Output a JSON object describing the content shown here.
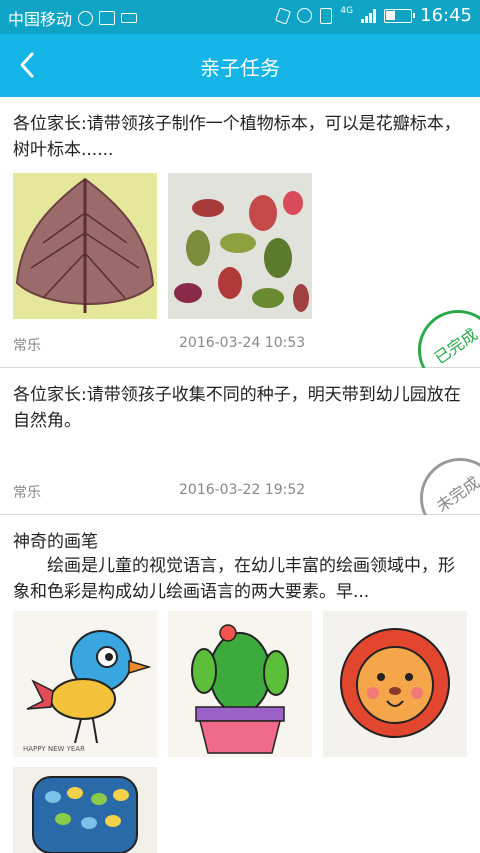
{
  "status_bar": {
    "carrier": "中国移动",
    "network": "4G",
    "time": "16:45",
    "icons": [
      "wechat-icon",
      "image-icon",
      "keyboard-icon",
      "vibrate-icon",
      "alarm-icon",
      "sim-icon",
      "signal-icon",
      "battery-icon"
    ]
  },
  "header": {
    "title": "亲子任务",
    "back_icon": "chevron-left-icon"
  },
  "colors": {
    "status_bar": "#0fa3c6",
    "header": "#14b4e6",
    "done_stamp": "#2aa84a",
    "todo_stamp": "#999999",
    "meta_text": "#888888"
  },
  "tasks": [
    {
      "text": "各位家长:请带领孩子制作一个植物标本，可以是花瓣标本，树叶标本......",
      "author": "常乐",
      "date": "2016-03-24 10:53",
      "stamp": "已完成",
      "images": [
        "leaf-skeleton-image",
        "pressed-leaves-image"
      ]
    },
    {
      "text": "各位家长:请带领孩子收集不同的种子，明天带到幼儿园放在自然角。",
      "author": "常乐",
      "date": "2016-03-22 19:52",
      "stamp": "未完成",
      "images": []
    },
    {
      "title": "神奇的画笔",
      "text": "绘画是儿童的视觉语言，在幼儿丰富的绘画领域中，形象和色彩是构成幼儿绘画语言的两大要素。早...",
      "images": [
        "bird-drawing-image",
        "cactus-drawing-image",
        "lion-drawing-image",
        "tree-drawing-image"
      ],
      "bird_caption": "HAPPY NEW YEAR"
    }
  ]
}
